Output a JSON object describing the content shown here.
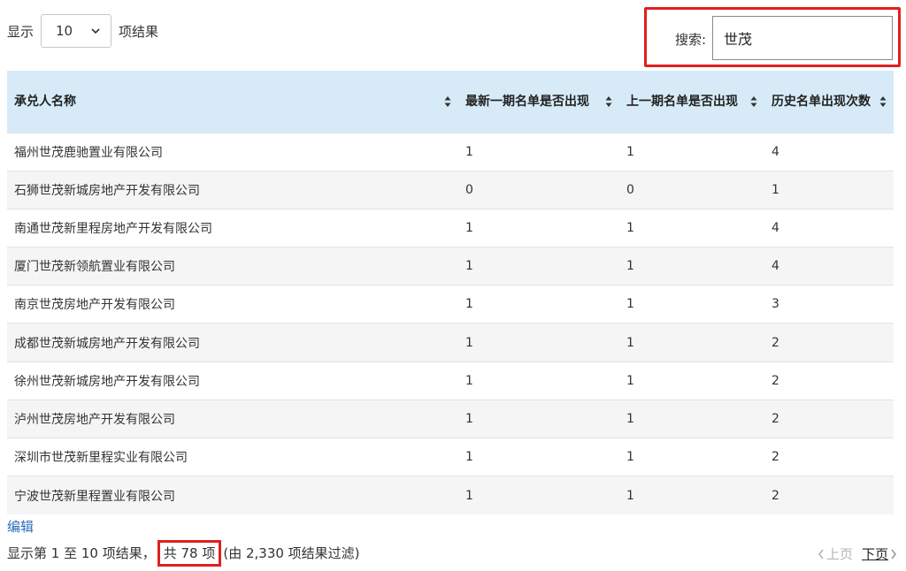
{
  "length_ctrl": {
    "prefix": "显示",
    "selected": "10",
    "suffix": "项结果"
  },
  "search": {
    "label": "搜索:",
    "value": "世茂"
  },
  "table": {
    "headers": [
      "承兑人名称",
      "最新一期名单是否出现",
      "上一期名单是否出现",
      "历史名单出现次数"
    ],
    "rows": [
      [
        "福州世茂鹿驰置业有限公司",
        "1",
        "1",
        "4"
      ],
      [
        "石狮世茂新城房地产开发有限公司",
        "0",
        "0",
        "1"
      ],
      [
        "南通世茂新里程房地产开发有限公司",
        "1",
        "1",
        "4"
      ],
      [
        "厦门世茂新领航置业有限公司",
        "1",
        "1",
        "4"
      ],
      [
        "南京世茂房地产开发有限公司",
        "1",
        "1",
        "3"
      ],
      [
        "成都世茂新城房地产开发有限公司",
        "1",
        "1",
        "2"
      ],
      [
        "徐州世茂新城房地产开发有限公司",
        "1",
        "1",
        "2"
      ],
      [
        "泸州世茂房地产开发有限公司",
        "1",
        "1",
        "2"
      ],
      [
        "深圳市世茂新里程实业有限公司",
        "1",
        "1",
        "2"
      ],
      [
        "宁波世茂新里程置业有限公司",
        "1",
        "1",
        "2"
      ]
    ]
  },
  "edit_link": "编辑",
  "info": {
    "before": "显示第 1 至 10 项结果，",
    "highlight": "共 78 项",
    "after": "(由 2,330 项结果过滤)"
  },
  "pager": {
    "prev": "上页",
    "next": "下页"
  },
  "colors": {
    "header_bg": "#d6ebf7",
    "highlight_border": "#e02020",
    "link": "#2a6eb8"
  }
}
